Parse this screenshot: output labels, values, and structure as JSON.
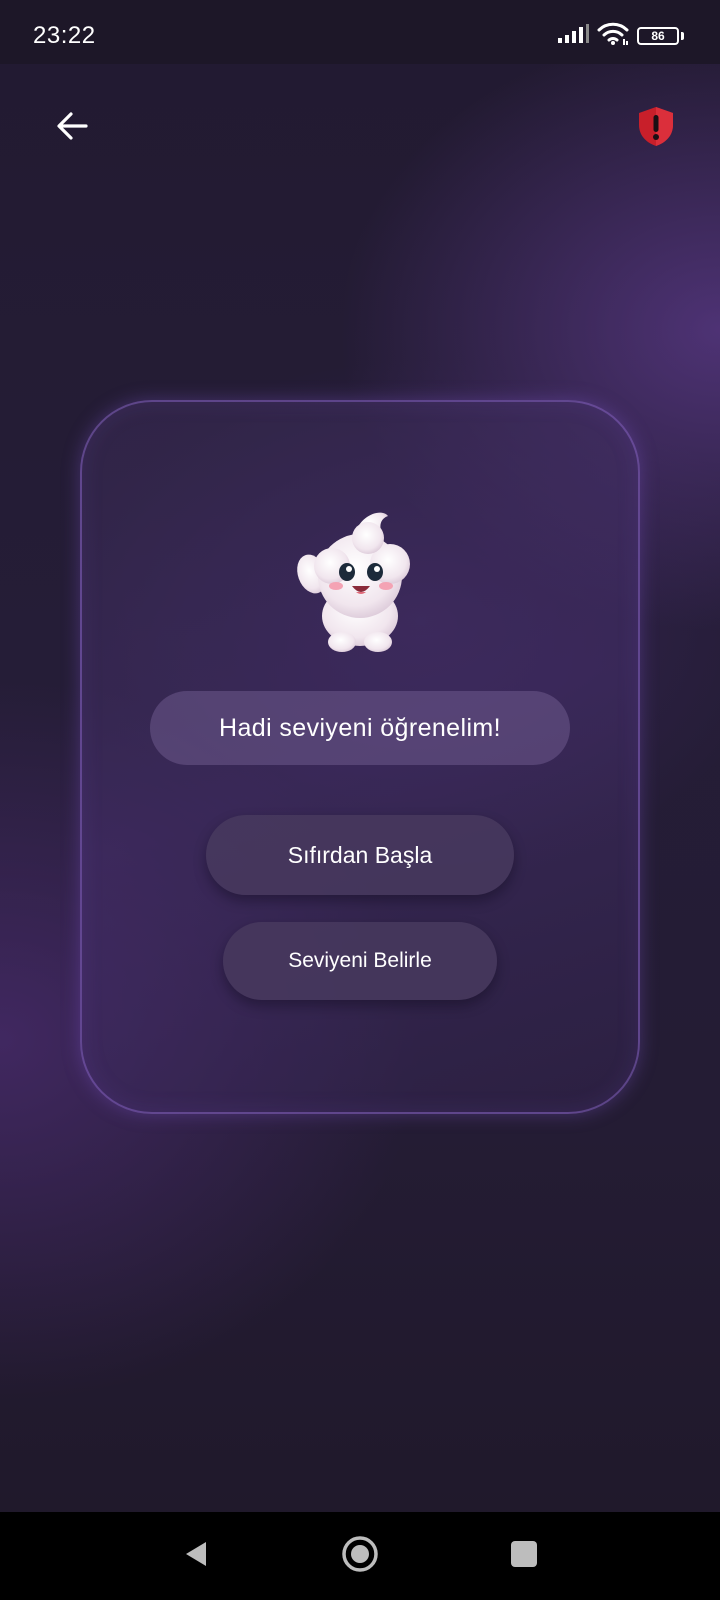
{
  "status_bar": {
    "time": "23:22",
    "battery": "86",
    "icons": [
      "signal-icon",
      "wifi-icon",
      "battery-icon"
    ]
  },
  "top_bar": {
    "back_icon": "arrow-left-icon",
    "shield_icon": "shield-alert-icon",
    "shield_color": "#d8262f"
  },
  "card": {
    "mascot": "waving-cloud-mascot",
    "prompt": "Hadi seviyeni öğrenelim!",
    "start_button": "Sıfırdan Başla",
    "level_button": "Seviyeni Belirle"
  },
  "nav_bar": {
    "icons": [
      "back-triangle-icon",
      "home-circle-icon",
      "recents-square-icon"
    ]
  },
  "colors": {
    "background": "#221a31",
    "card_border": "#8e63d6",
    "button": "#483a5e",
    "text": "#ffffff"
  }
}
